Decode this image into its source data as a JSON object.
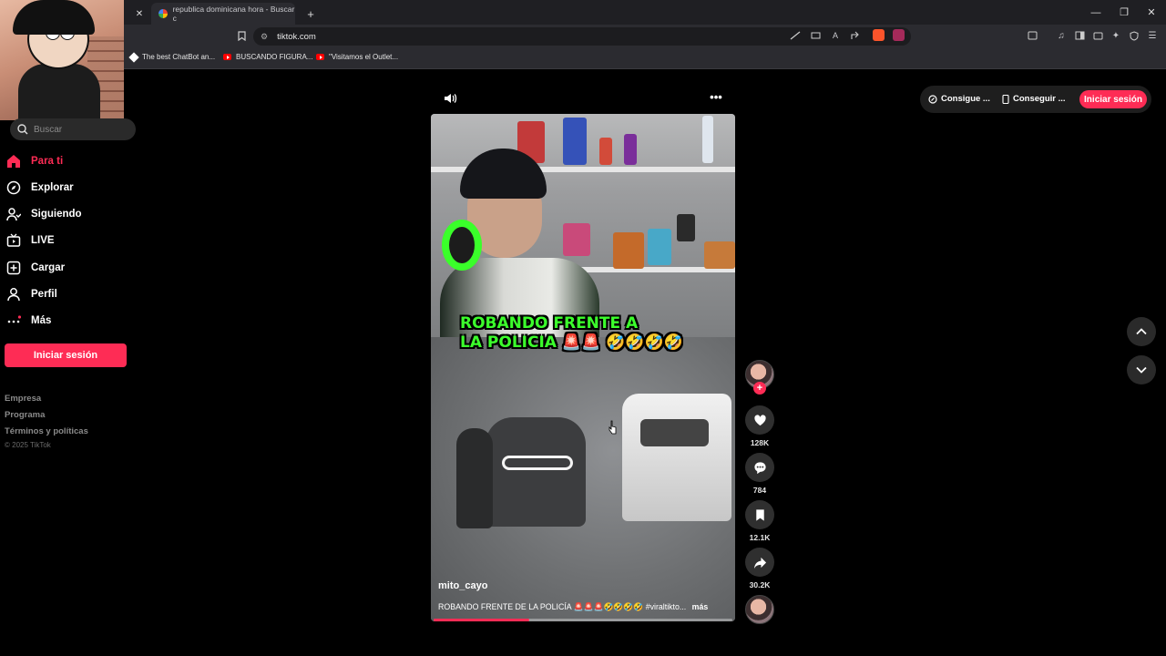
{
  "browser": {
    "active_tab_title": "republica dominicana hora - Buscar c",
    "new_tab_symbol": "+",
    "close_tab_symbol": "✕",
    "url": "tiktok.com",
    "window_controls": {
      "minimize": "—",
      "restore": "❐",
      "close": "✕"
    },
    "bookmarks": [
      {
        "label": "The best ChatBot an...",
        "icon": "chatbot-icon"
      },
      {
        "label": "BUSCANDO FIGURA...",
        "icon": "youtube-icon"
      },
      {
        "label": "\"Visitamos el Outlet...",
        "icon": "youtube-icon"
      }
    ]
  },
  "sidebar": {
    "search_placeholder": "Buscar",
    "nav": [
      {
        "label": "Para ti",
        "icon": "home-icon",
        "active": true
      },
      {
        "label": "Explorar",
        "icon": "compass-icon"
      },
      {
        "label": "Siguiendo",
        "icon": "following-icon"
      },
      {
        "label": "LIVE",
        "icon": "live-tv-icon"
      },
      {
        "label": "Cargar",
        "icon": "upload-plus-icon"
      },
      {
        "label": "Perfil",
        "icon": "profile-icon"
      },
      {
        "label": "Más",
        "icon": "more-dots-icon"
      }
    ],
    "login_button": "Iniciar sesión",
    "footer_links": [
      "Empresa",
      "Programa",
      "Términos y políticas"
    ],
    "copyright": "© 2025 TikTok"
  },
  "video": {
    "overlay_caption_line1": "ROBANDO FRENTE A",
    "overlay_caption_line2": "LA POLICIA 🚨🚨 🤣🤣🤣🤣",
    "username": "mito_cayo",
    "description": "ROBANDO FRENTE DE LA POLICÍA 🚨🚨🚨🤣🤣🤣🤣 #viraltikto...",
    "more_label": "más",
    "progress": 0.32
  },
  "actions": {
    "likes": "128K",
    "comments": "784",
    "saves": "12.1K",
    "shares": "30.2K",
    "follow_symbol": "+"
  },
  "top_right": {
    "coins_label": "Consigue ...",
    "app_label": "Conseguir ...",
    "login_label": "Iniciar sesión"
  },
  "colors": {
    "accent": "#fe2c55",
    "caption_green": "#3cff2c",
    "background": "#000000"
  }
}
